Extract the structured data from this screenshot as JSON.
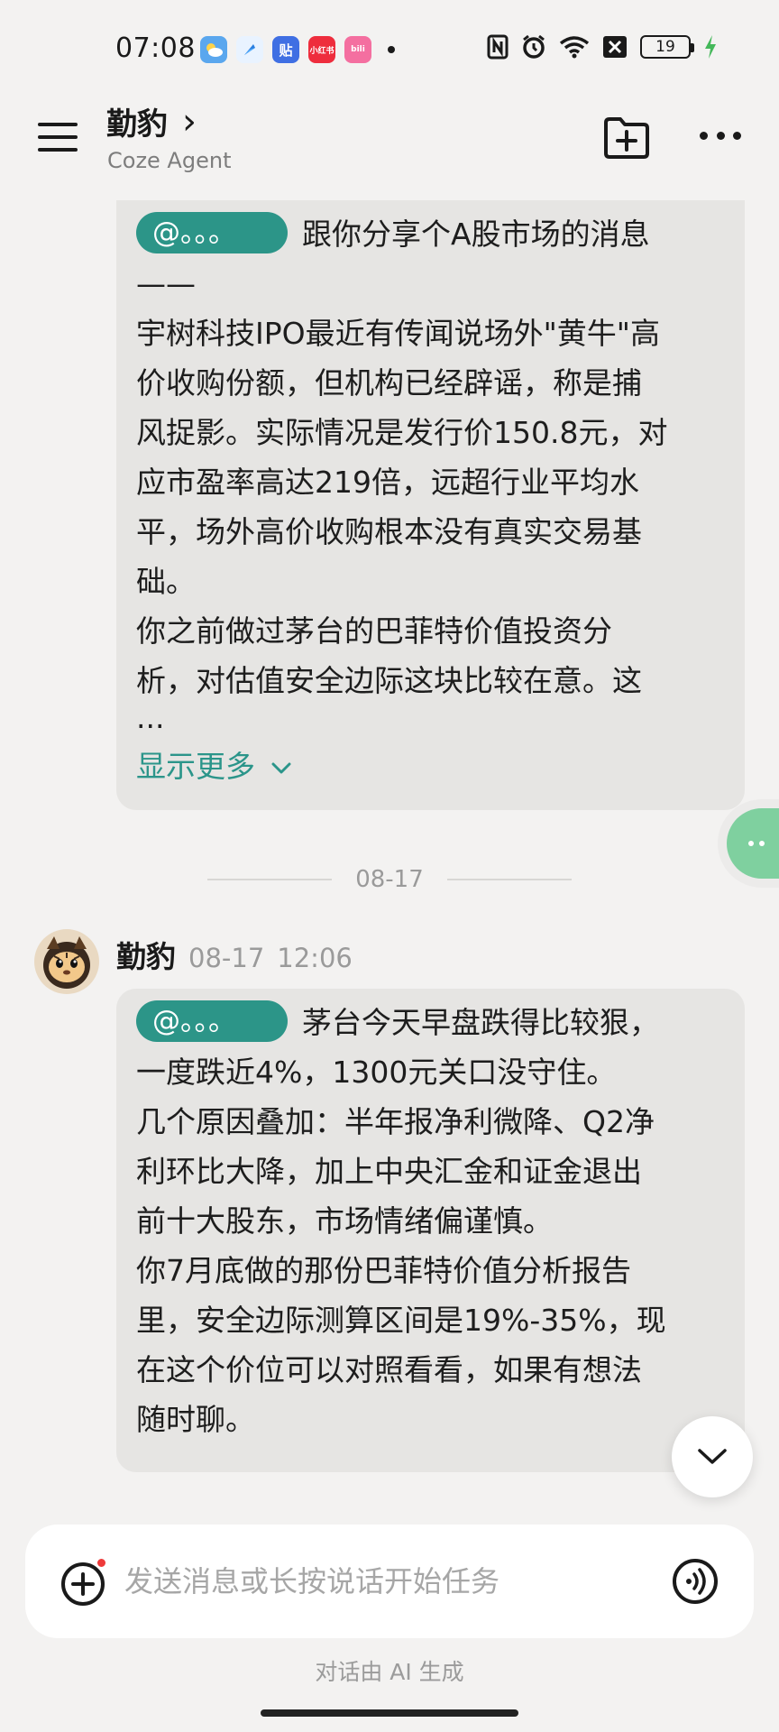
{
  "status_bar": {
    "time": "07:08",
    "battery": "19",
    "app_icons": [
      "weather-icon",
      "browser-icon",
      "tieba-icon",
      "xiaohongshu-icon",
      "bilibili-icon"
    ],
    "right_icons": [
      "nfc-icon",
      "alarm-icon",
      "wifi-icon",
      "sim-off-icon",
      "battery-icon",
      "charging-icon"
    ]
  },
  "header": {
    "title": "勤豹",
    "chevron": "›",
    "subtitle": "Coze Agent"
  },
  "messages": [
    {
      "mention": "@。。。",
      "lines": [
        "跟你分享个A股市场的消息",
        "——",
        "宇树科技IPO最近有传闻说场外\"黄牛\"高",
        "价收购份额，但机构已经辟谣，称是捕",
        "风捉影。实际情况是发行价150.8元，对",
        "应市盈率高达219倍，远超行业平均水",
        "平，场外高价收购根本没有真实交易基",
        "础。",
        "你之前做过茅台的巴菲特价值投资分",
        "析，对估值安全边际这块比较在意。这",
        "..."
      ],
      "show_more": "显示更多"
    },
    {
      "sender": "勤豹",
      "date": "08-17",
      "time": "12:06",
      "mention": "@。。。",
      "lines": [
        "茅台今天早盘跌得比较狠，",
        "一度跌近4%，1300元关口没守住。",
        "几个原因叠加：半年报净利微降、Q2净",
        "利环比大降，加上中央汇金和证金退出",
        "前十大股东，市场情绪偏谨慎。",
        "你7月底做的那份巴菲特价值分析报告",
        "里，安全边际测算区间是19%-35%，现",
        "在这个价位可以对照看看，如果有想法",
        "随时聊。"
      ]
    }
  ],
  "date_divider": "08-17",
  "input": {
    "placeholder": "发送消息或长按说话开始任务"
  },
  "footer_note": "对话由 AI 生成",
  "colors": {
    "background": "#f3f2f1",
    "bubble": "#e6e5e3",
    "accent": "#2c9588",
    "side_pill": "#7fd09f"
  }
}
